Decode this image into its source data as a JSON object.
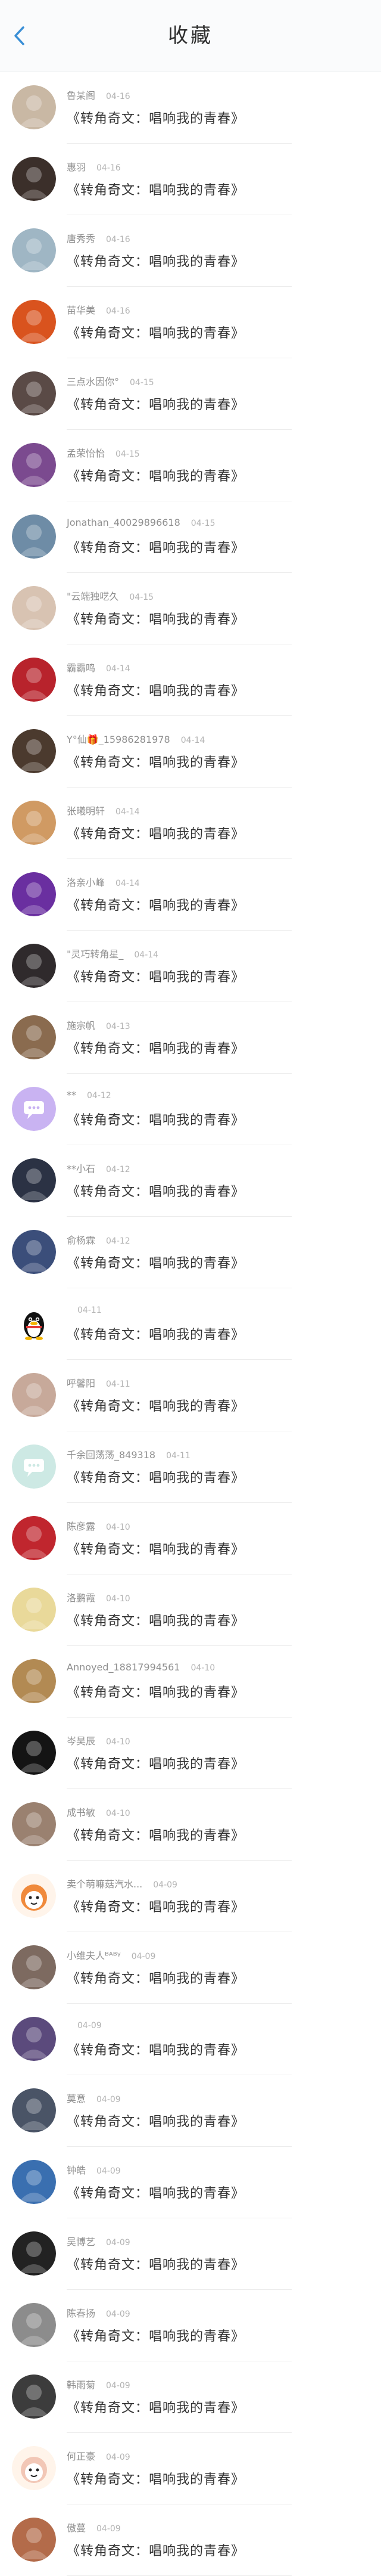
{
  "header": {
    "title": "收藏",
    "back_icon": "chevron-left-icon",
    "accent_color": "#3a8fd6"
  },
  "items": [
    {
      "name": "鲁某阁",
      "date": "04-16",
      "content": "《转角奇文：唱响我的青春》",
      "avatar": "photo-avatar-icon",
      "avatar_color": "#c9b8a4"
    },
    {
      "name": "惠羽",
      "date": "04-16",
      "content": "《转角奇文：唱响我的青春》",
      "avatar": "photo-avatar-icon",
      "avatar_color": "#3b2f2a"
    },
    {
      "name": "唐秀秀",
      "date": "04-16",
      "content": "《转角奇文：唱响我的青春》",
      "avatar": "photo-avatar-icon",
      "avatar_color": "#9fb6c4"
    },
    {
      "name": "苗华美",
      "date": "04-16",
      "content": "《转角奇文：唱响我的青春》",
      "avatar": "photo-avatar-icon",
      "avatar_color": "#d9531e"
    },
    {
      "name": "三点水因你°",
      "date": "04-15",
      "content": "《转角奇文：唱响我的青春》",
      "avatar": "photo-avatar-icon",
      "avatar_color": "#5a4a46"
    },
    {
      "name": "孟荣怡怡",
      "date": "04-15",
      "content": "《转角奇文：唱响我的青春》",
      "avatar": "photo-avatar-icon",
      "avatar_color": "#7b4a8f"
    },
    {
      "name": "Jonathan_40029896618",
      "date": "04-15",
      "content": "《转角奇文：唱响我的青春》",
      "avatar": "photo-avatar-icon",
      "avatar_color": "#6e8ca6"
    },
    {
      "name": "\"云端独呓久",
      "date": "04-15",
      "content": "《转角奇文：唱响我的青春》",
      "avatar": "photo-avatar-icon",
      "avatar_color": "#d8c3b2"
    },
    {
      "name": "霸霸鸣",
      "date": "04-14",
      "content": "《转角奇文：唱响我的青春》",
      "avatar": "photo-avatar-icon",
      "avatar_color": "#b8232c"
    },
    {
      "name": "Y°仙🎁_15986281978",
      "date": "04-14",
      "content": "《转角奇文：唱响我的青春》",
      "avatar": "photo-avatar-icon",
      "avatar_color": "#4b3a2e"
    },
    {
      "name": "张曦明轩",
      "date": "04-14",
      "content": "《转角奇文：唱响我的青春》",
      "avatar": "photo-avatar-icon",
      "avatar_color": "#d09a63"
    },
    {
      "name": "洛亲小峰",
      "date": "04-14",
      "content": "《转角奇文：唱响我的青春》",
      "avatar": "photo-avatar-icon",
      "avatar_color": "#6a2fa0"
    },
    {
      "name": "\"灵巧转角星_",
      "date": "04-14",
      "content": "《转角奇文：唱响我的青春》",
      "avatar": "photo-avatar-icon",
      "avatar_color": "#2f2a2c"
    },
    {
      "name": "施宗帆",
      "date": "04-13",
      "content": "《转角奇文：唱响我的青春》",
      "avatar": "photo-avatar-icon",
      "avatar_color": "#8a6b4f"
    },
    {
      "name": "**",
      "date": "04-12",
      "content": "《转角奇文：唱响我的青春》",
      "avatar": "chat-bubble-avatar-icon",
      "avatar_color": "#c9b3f2"
    },
    {
      "name": "**小石",
      "date": "04-12",
      "content": "《转角奇文：唱响我的青春》",
      "avatar": "photo-avatar-icon",
      "avatar_color": "#2b3244"
    },
    {
      "name": "俞杨霖",
      "date": "04-12",
      "content": "《转角奇文：唱响我的青春》",
      "avatar": "photo-avatar-icon",
      "avatar_color": "#3b4e7a"
    },
    {
      "name": "",
      "date": "04-11",
      "content": "《转角奇文：唱响我的青春》",
      "avatar": "penguin-avatar-icon",
      "avatar_color": "#111111"
    },
    {
      "name": "呼馨阳",
      "date": "04-11",
      "content": "《转角奇文：唱响我的青春》",
      "avatar": "photo-avatar-icon",
      "avatar_color": "#c7a99a"
    },
    {
      "name": "千余回荡荡_849318",
      "date": "04-11",
      "content": "《转角奇文：唱响我的青春》",
      "avatar": "chat-bubble-avatar-icon",
      "avatar_color": "#cde9e4"
    },
    {
      "name": "陈彦露",
      "date": "04-10",
      "content": "《转角奇文：唱响我的青春》",
      "avatar": "photo-avatar-icon",
      "avatar_color": "#c0262e"
    },
    {
      "name": "洛鹏霞",
      "date": "04-10",
      "content": "《转角奇文：唱响我的青春》",
      "avatar": "photo-avatar-icon",
      "avatar_color": "#e9d99a"
    },
    {
      "name": "Annoyed_18817994561",
      "date": "04-10",
      "content": "《转角奇文：唱响我的青春》",
      "avatar": "photo-avatar-icon",
      "avatar_color": "#b28a53"
    },
    {
      "name": "岑昊辰",
      "date": "04-10",
      "content": "《转角奇文：唱响我的青春》",
      "avatar": "photo-avatar-icon",
      "avatar_color": "#141414"
    },
    {
      "name": "成书敏",
      "date": "04-10",
      "content": "《转角奇文：唱响我的青春》",
      "avatar": "photo-avatar-icon",
      "avatar_color": "#9a8170"
    },
    {
      "name": "卖个萌嘛菇汽水...",
      "date": "04-09",
      "content": "《转角奇文：唱响我的青春》",
      "avatar": "cartoon-avatar-icon",
      "avatar_color": "#f08a3c"
    },
    {
      "name": "小维夫人ᴮᴬᴮᵞ",
      "date": "04-09",
      "content": "《转角奇文：唱响我的青春》",
      "avatar": "photo-avatar-icon",
      "avatar_color": "#7d6a60"
    },
    {
      "name": "",
      "date": "04-09",
      "content": "《转角奇文：唱响我的青春》",
      "avatar": "photo-avatar-icon",
      "avatar_color": "#5b4a7c"
    },
    {
      "name": "莫意",
      "date": "04-09",
      "content": "《转角奇文：唱响我的青春》",
      "avatar": "photo-avatar-icon",
      "avatar_color": "#4a5466"
    },
    {
      "name": "钟皓",
      "date": "04-09",
      "content": "《转角奇文：唱响我的青春》",
      "avatar": "photo-avatar-icon",
      "avatar_color": "#3a6fb0"
    },
    {
      "name": "吴博艺",
      "date": "04-09",
      "content": "《转角奇文：唱响我的青春》",
      "avatar": "photo-avatar-icon",
      "avatar_color": "#222222"
    },
    {
      "name": "陈春扬",
      "date": "04-09",
      "content": "《转角奇文：唱响我的青春》",
      "avatar": "photo-avatar-icon",
      "avatar_color": "#8c8c8c"
    },
    {
      "name": "韩雨菊",
      "date": "04-09",
      "content": "《转角奇文：唱响我的青春》",
      "avatar": "photo-avatar-icon",
      "avatar_color": "#3c3c3c"
    },
    {
      "name": "何正豪",
      "date": "04-09",
      "content": "《转角奇文：唱响我的青春》",
      "avatar": "cartoon-avatar-icon",
      "avatar_color": "#f2c7b6"
    },
    {
      "name": "傲蔓",
      "date": "04-09",
      "content": "《转角奇文：唱响我的青春》",
      "avatar": "photo-avatar-icon",
      "avatar_color": "#b36b4a"
    }
  ]
}
